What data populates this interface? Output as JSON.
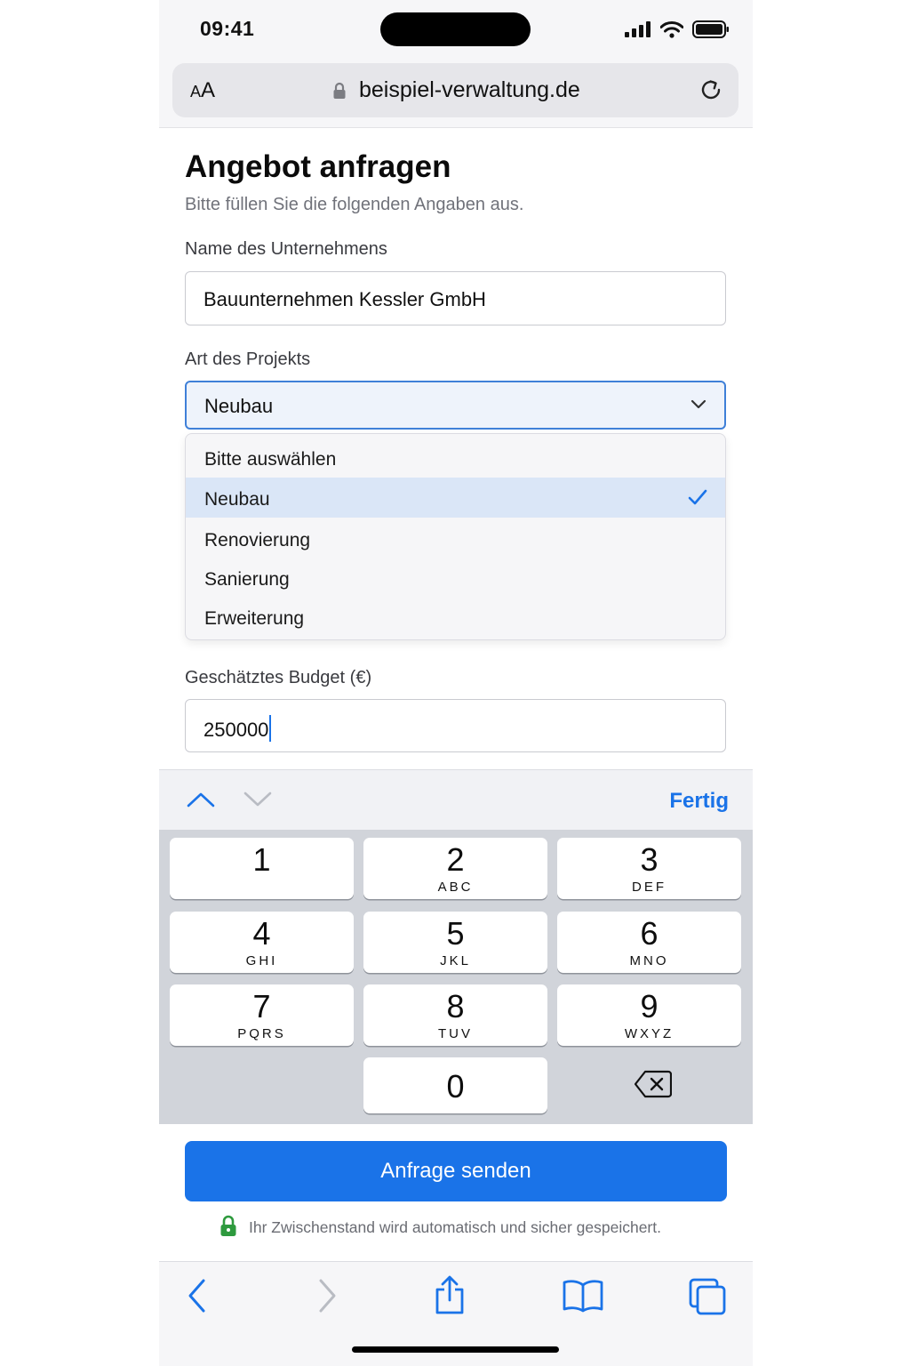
{
  "status_bar": {
    "time": "09:41"
  },
  "browser": {
    "text_size_button": "AA",
    "url": "beispiel-verwaltung.de"
  },
  "form": {
    "title": "Angebot anfragen",
    "subtitle": "Bitte füllen Sie die folgenden Angaben aus.",
    "company": {
      "label": "Name des Unternehmens",
      "value": "Bauunternehmen Kessler GmbH"
    },
    "project_type": {
      "label": "Art des Projekts",
      "value": "Neubau",
      "options": [
        "Bitte auswählen",
        "Neubau",
        "Renovierung",
        "Sanierung",
        "Erweiterung"
      ],
      "selected_index": 1
    },
    "budget": {
      "label": "Geschätztes Budget (€)",
      "value": "250000"
    },
    "submit_label": "Anfrage senden",
    "autosave_note": "Ihr Zwischenstand wird automatisch und sicher gespeichert."
  },
  "keyboard": {
    "done_label": "Fertig",
    "keys": [
      {
        "num": "1",
        "letters": ""
      },
      {
        "num": "2",
        "letters": "ABC"
      },
      {
        "num": "3",
        "letters": "DEF"
      },
      {
        "num": "4",
        "letters": "GHI"
      },
      {
        "num": "5",
        "letters": "JKL"
      },
      {
        "num": "6",
        "letters": "MNO"
      },
      {
        "num": "7",
        "letters": "PQRS"
      },
      {
        "num": "8",
        "letters": "TUV"
      },
      {
        "num": "9",
        "letters": "WXYZ"
      },
      {
        "num": "0",
        "letters": ""
      }
    ]
  },
  "colors": {
    "accent": "#1a73e8",
    "lock_green": "#2e9a3e"
  },
  "icons": [
    "signal-icon",
    "wifi-icon",
    "battery-icon",
    "lock-icon",
    "reload-icon",
    "chevron-down-icon",
    "checkmark-icon",
    "chevron-up-icon",
    "backspace-icon",
    "back-icon",
    "forward-icon",
    "share-icon",
    "bookmarks-icon",
    "tabs-icon"
  ]
}
